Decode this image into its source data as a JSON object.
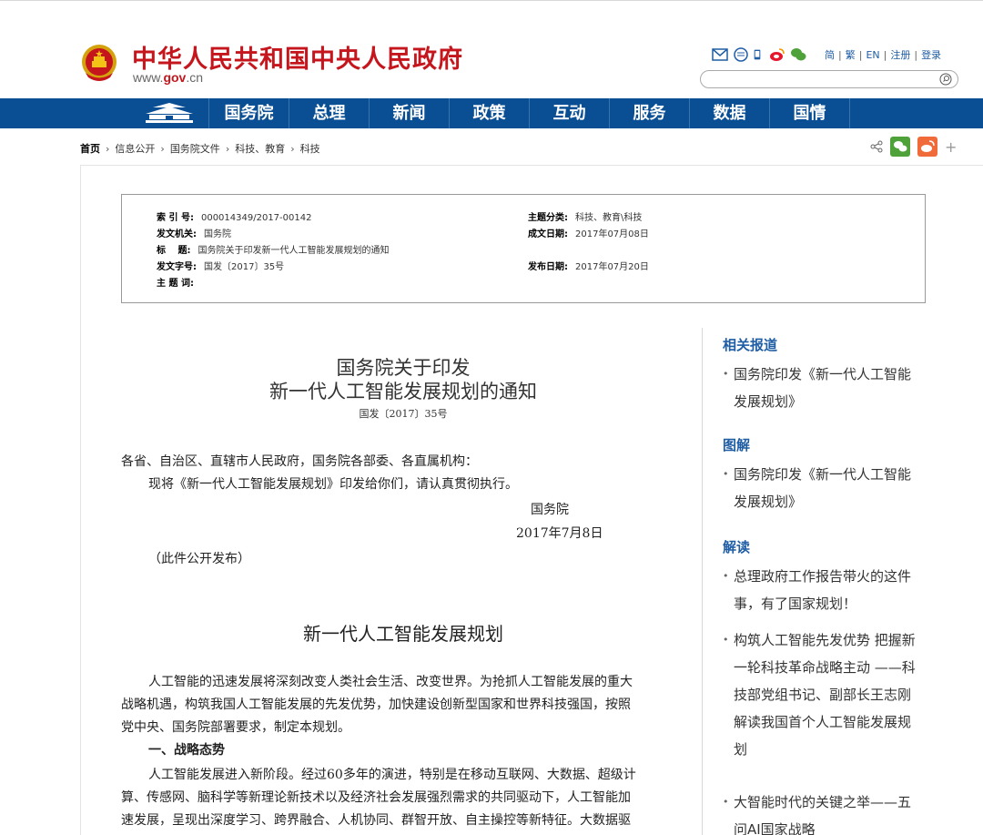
{
  "header": {
    "site_title": "中华人民共和国中央人民政府",
    "site_url_prefix": "www.",
    "site_url_domain": "gov",
    "site_url_suffix": ".cn",
    "top_links": [
      "简",
      "繁",
      "EN",
      "注册",
      "登录"
    ],
    "search_placeholder": ""
  },
  "nav": {
    "items": [
      "国务院",
      "总理",
      "新闻",
      "政策",
      "互动",
      "服务",
      "数据",
      "国情"
    ]
  },
  "breadcrumb": {
    "items": [
      "首页",
      "信息公开",
      "国务院文件",
      "科技、教育",
      "科技"
    ]
  },
  "meta": {
    "index_label": "索 引 号:",
    "index_value": "000014349/2017-00142",
    "issuer_label": "发文机关:",
    "issuer_value": "国务院",
    "title_label": "标　 题:",
    "title_value": "国务院关于印发新一代人工智能发展规划的通知",
    "docno_label": "发文字号:",
    "docno_value": "国发〔2017〕35号",
    "keyword_label": "主 题 词:",
    "keyword_value": "",
    "category_label": "主题分类:",
    "category_value": "科技、教育\\科技",
    "written_label": "成文日期:",
    "written_value": "2017年07月08日",
    "published_label": "发布日期:",
    "published_value": "2017年07月20日"
  },
  "article": {
    "title_line1": "国务院关于印发",
    "title_line2": "新一代人工智能发展规划的通知",
    "doc_number": "国发〔2017〕35号",
    "recipients": "各省、自治区、直辖市人民政府，国务院各部委、各直属机构：",
    "notice": "现将《新一代人工智能发展规划》印发给你们，请认真贯彻执行。",
    "signer": "国务院",
    "date": "2017年7月8日",
    "public_note": "（此件公开发布）",
    "plan_title": "新一代人工智能发展规划",
    "p1_l1": "人工智能的迅速发展将深刻改变人类社会生活、改变世界。为抢抓人工智能发展的重大",
    "p1_l2": "战略机遇，构筑我国人工智能发展的先发优势，加快建设创新型国家和世界科技强国，按照",
    "p1_l3": "党中央、国务院部署要求，制定本规划。",
    "section1": "一、战略态势",
    "p2_l1": "人工智能发展进入新阶段。经过60多年的演进，特别是在移动互联网、大数据、超级计",
    "p2_l2": "算、传感网、脑科学等新理论新技术以及经济社会发展强烈需求的共同驱动下，人工智能加",
    "p2_l3": "速发展，呈现出深度学习、跨界融合、人机协同、群智开放、自主操控等新特征。大数据驱"
  },
  "sidebar": {
    "related_head": "相关报道",
    "related_l1": "国务院印发《新一代人工智能",
    "related_l2": "发展规划》",
    "graphic_head": "图解",
    "graphic_l1": "国务院印发《新一代人工智能",
    "graphic_l2": "发展规划》",
    "interp_head": "解读",
    "i1_l1": "总理政府工作报告带火的这件",
    "i1_l2": "事，有了国家规划！",
    "i2_l1": "构筑人工智能先发优势 把握新",
    "i2_l2": "一轮科技革命战略主动 ——科",
    "i2_l3": "技部党组书记、副部长王志刚",
    "i2_l4": "解读我国首个人工智能发展规",
    "i2_l5": "划",
    "i3_l1": "大智能时代的关键之举——五",
    "i3_l2": "问AI国家战略"
  },
  "colors": {
    "brand_red": "#c4161c",
    "nav_blue": "#0a4f93",
    "link_blue": "#1f5da4"
  }
}
